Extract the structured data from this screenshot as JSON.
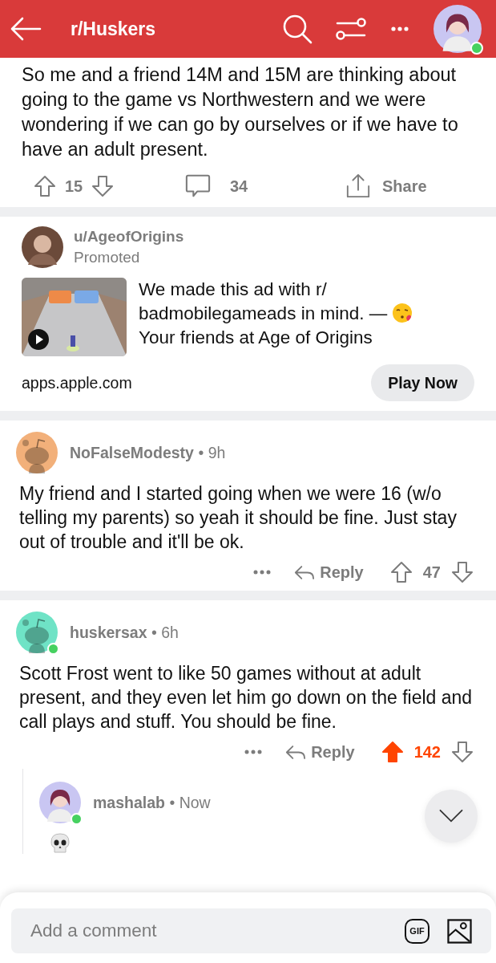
{
  "header": {
    "title": "r/Huskers",
    "user_online": true
  },
  "post": {
    "body": "So me and a friend 14M and 15M are thinking about going to the game vs Northwestern and we were wondering if we can go by ourselves or if we have to have an adult present.",
    "score": "15",
    "upvoted": false,
    "comment_count": "34",
    "share_label": "Share"
  },
  "ad": {
    "user": "u/AgeofOrigins",
    "promoted_label": "Promoted",
    "text": "We made this ad with r/ badmobilegameads in mind. —",
    "text_end": "Your friends at Age of Origins",
    "domain": "apps.apple.com",
    "cta": "Play Now"
  },
  "comments": [
    {
      "kind": "text",
      "author": "NoFalseModesty",
      "meta_separator": "•",
      "time": "9h",
      "avatar": {
        "kind": "snoo",
        "color": "#f2b07a"
      },
      "online": false,
      "body": "My friend and I started going when we were 16 (w/o telling my parents) so yeah it should be fine. Just stay out of trouble and it'll be ok.",
      "reply_label": "Reply",
      "score": "47",
      "upvoted": false
    },
    {
      "kind": "text",
      "author": "huskersax",
      "meta_separator": "•",
      "time": "6h",
      "avatar": {
        "kind": "snoo",
        "color": "#6fe3c6"
      },
      "online": true,
      "body": "Scott Frost went to like 50 games without at adult present, and they even let him go down on the field and call plays and stuff. You should be fine.",
      "reply_label": "Reply",
      "score": "142",
      "upvoted": true,
      "children": [
        {
          "kind": "skull_emoji",
          "author": "mashalab",
          "meta_separator": "•",
          "time": "Now",
          "avatar": {
            "kind": "figure",
            "color": "#c9c6f2"
          },
          "online": true
        }
      ]
    }
  ],
  "composer": {
    "placeholder": "Add a comment",
    "gif_label": "GIF"
  }
}
